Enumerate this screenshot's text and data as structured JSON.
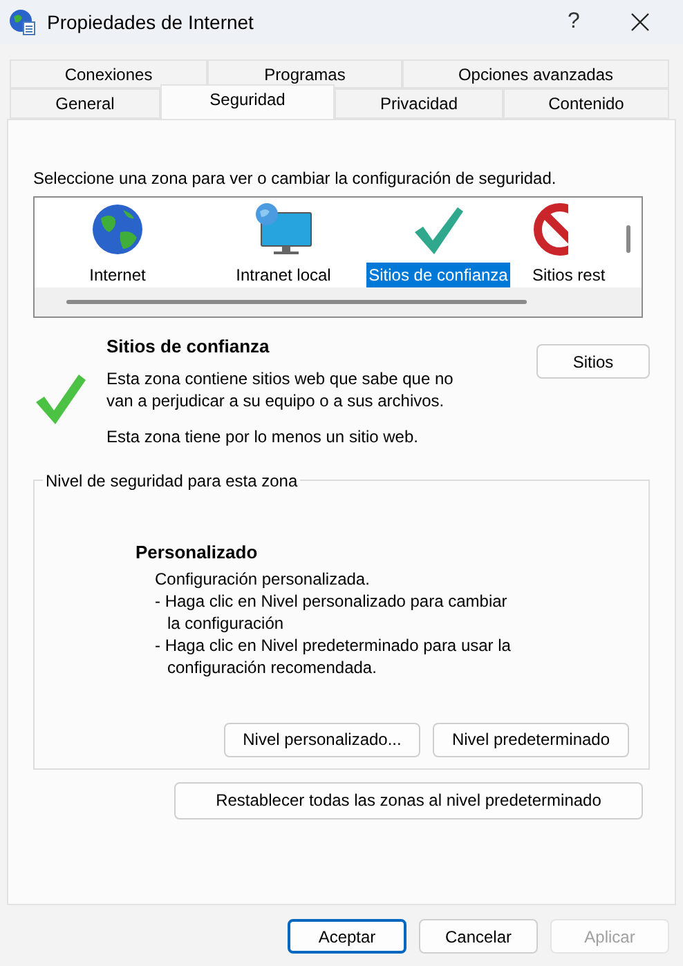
{
  "window": {
    "title": "Propiedades de Internet",
    "help": "?"
  },
  "tab_rows": [
    {
      "tabs": [
        {
          "label": "Conexiones",
          "selected": false
        },
        {
          "label": "Programas",
          "selected": false
        },
        {
          "label": "Opciones avanzadas",
          "selected": false
        }
      ]
    },
    {
      "tabs": [
        {
          "label": "General",
          "selected": false
        },
        {
          "label": "Seguridad",
          "selected": true
        },
        {
          "label": "Privacidad",
          "selected": false
        },
        {
          "label": "Contenido",
          "selected": false
        }
      ]
    }
  ],
  "zone_prompt": "Seleccione una zona para ver o cambiar la configuración de seguridad.",
  "zones": [
    {
      "kind": "globe",
      "label": "Internet",
      "selected": false
    },
    {
      "kind": "monitor",
      "label": "Intranet local",
      "selected": false
    },
    {
      "kind": "check",
      "label": "Sitios de confianza",
      "selected": true
    },
    {
      "kind": "blocked",
      "label": "Sitios rest",
      "selected": false
    }
  ],
  "zone_info": {
    "title": "Sitios de confianza",
    "description": [
      "Esta zona contiene sitios web que sabe que no",
      "van a perjudicar a su equipo o a sus archivos."
    ],
    "note": "Esta zona tiene por lo menos un sitio web.",
    "button": "Sitios"
  },
  "security_level": {
    "legend": "Nivel de seguridad para esta zona",
    "title": "Personalizado",
    "lines": [
      {
        "text": "Configuración personalizada.",
        "kind": "plain"
      },
      {
        "text": "- Haga clic en Nivel personalizado para cambiar",
        "kind": "plain"
      },
      {
        "text": "la configuración",
        "kind": "continued"
      },
      {
        "text": "- Haga clic en Nivel predeterminado para usar la",
        "kind": "plain"
      },
      {
        "text": "configuración recomendada.",
        "kind": "continued"
      }
    ],
    "buttons": [
      "Nivel personalizado...",
      "Nivel predeterminado"
    ]
  },
  "reset_button": "Restablecer todas las zonas al nivel predeterminado",
  "footer_buttons": [
    {
      "label": "Aceptar",
      "kind": "default",
      "disabled": false
    },
    {
      "label": "Cancelar",
      "kind": "normal",
      "disabled": false
    },
    {
      "label": "Aplicar",
      "kind": "normal",
      "disabled": true
    }
  ]
}
